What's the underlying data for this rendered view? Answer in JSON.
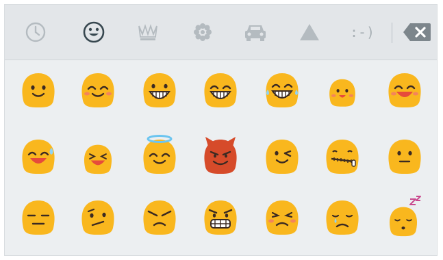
{
  "tabs": [
    {
      "name": "recents-tab",
      "icon": "clock-icon",
      "active": false
    },
    {
      "name": "smileys-tab",
      "icon": "smiley-icon",
      "active": true
    },
    {
      "name": "objects-tab",
      "icon": "crown-icon",
      "active": false
    },
    {
      "name": "nature-tab",
      "icon": "flower-icon",
      "active": false
    },
    {
      "name": "places-tab",
      "icon": "car-icon",
      "active": false
    },
    {
      "name": "symbols-tab",
      "icon": "triangle-icon",
      "active": false
    },
    {
      "name": "emoticons-tab",
      "icon": "emoticon-text",
      "label": ":-)",
      "active": false
    }
  ],
  "delete_key": {
    "icon": "backspace-icon"
  },
  "colors": {
    "tab_bar": "#e3e6e9",
    "keyboard_bg": "#eceff1",
    "icon_inactive": "#b4bbc0",
    "icon_active": "#37474f",
    "emoji_yellow": "#f9b71e",
    "emoji_devil": "#d64b2a",
    "halo": "#6cc5f0"
  },
  "emojis": [
    [
      "smiling-face",
      "smiling-closed-eyes",
      "grinning-face",
      "grinning-closed-eyes",
      "tears-of-joy",
      "blushing-face",
      "laughing-face"
    ],
    [
      "laughing-sweat",
      "squinting-laughing",
      "halo-face",
      "devil-face",
      "winking-face",
      "zipper-mouth",
      "neutral-face"
    ],
    [
      "expressionless-face",
      "confused-face",
      "angry-face",
      "grimacing-face",
      "pouting-blush",
      "disappointed-face",
      "sleeping-face"
    ]
  ]
}
